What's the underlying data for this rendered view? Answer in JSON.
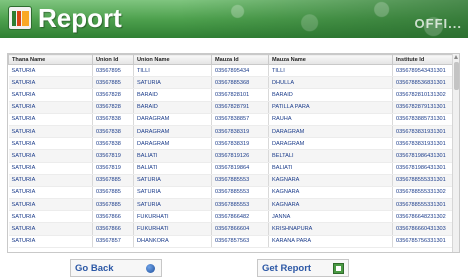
{
  "header": {
    "title": "Report",
    "banner_text": "OFFI..."
  },
  "table": {
    "columns": [
      "Thana Name",
      "Union Id",
      "Union Name",
      "Mauza Id",
      "Mauza Name",
      "Institute Id"
    ],
    "rows": [
      [
        "SATURIA",
        "03567895",
        "TILLI",
        "03567895434",
        "TILLI",
        "0356789543431301"
      ],
      [
        "SATURIA",
        "03567885",
        "SATURIA",
        "03567885368",
        "DHULLA",
        "0356788536831301"
      ],
      [
        "SATURIA",
        "03567828",
        "BARAID",
        "03567828101",
        "BARAID",
        "0356782810131302"
      ],
      [
        "SATURIA",
        "03567828",
        "BARAID",
        "03567828791",
        "PATILLA PARA",
        "0356782879131301"
      ],
      [
        "SATURIA",
        "03567838",
        "DARAGRAM",
        "03567838857",
        "RAUHA",
        "0356783885731301"
      ],
      [
        "SATURIA",
        "03567838",
        "DARAGRAM",
        "03567838319",
        "DARAGRAM",
        "0356783831931301"
      ],
      [
        "SATURIA",
        "03567838",
        "DARAGRAM",
        "03567838319",
        "DARAGRAM",
        "0356783831931301"
      ],
      [
        "SATURIA",
        "03567819",
        "BALIATI",
        "03567819126",
        "BELTALI",
        "0356781986431301"
      ],
      [
        "SATURIA",
        "03567819",
        "BALIATI",
        "03567819864",
        "BALIATI",
        "0356781986431301"
      ],
      [
        "SATURIA",
        "03567885",
        "SATURIA",
        "03567885553",
        "KAGNARA",
        "0356788555331301"
      ],
      [
        "SATURIA",
        "03567885",
        "SATURIA",
        "03567885553",
        "KAGNARA",
        "0356788555331302"
      ],
      [
        "SATURIA",
        "03567885",
        "SATURIA",
        "03567885553",
        "KAGNARA",
        "0356788555331301"
      ],
      [
        "SATURIA",
        "03567866",
        "FUKURHATI",
        "03567866482",
        "JANNA",
        "0356786648231302"
      ],
      [
        "SATURIA",
        "03567866",
        "FUKURHATI",
        "03567866604",
        "KRISHNAPURA",
        "0356786660431303"
      ],
      [
        "SATURIA",
        "03567857",
        "DHANKORA",
        "03567857563",
        "KARANA PARA",
        "0356785756331301"
      ]
    ]
  },
  "buttons": {
    "go_back": "Go Back",
    "get_report": "Get Report"
  }
}
